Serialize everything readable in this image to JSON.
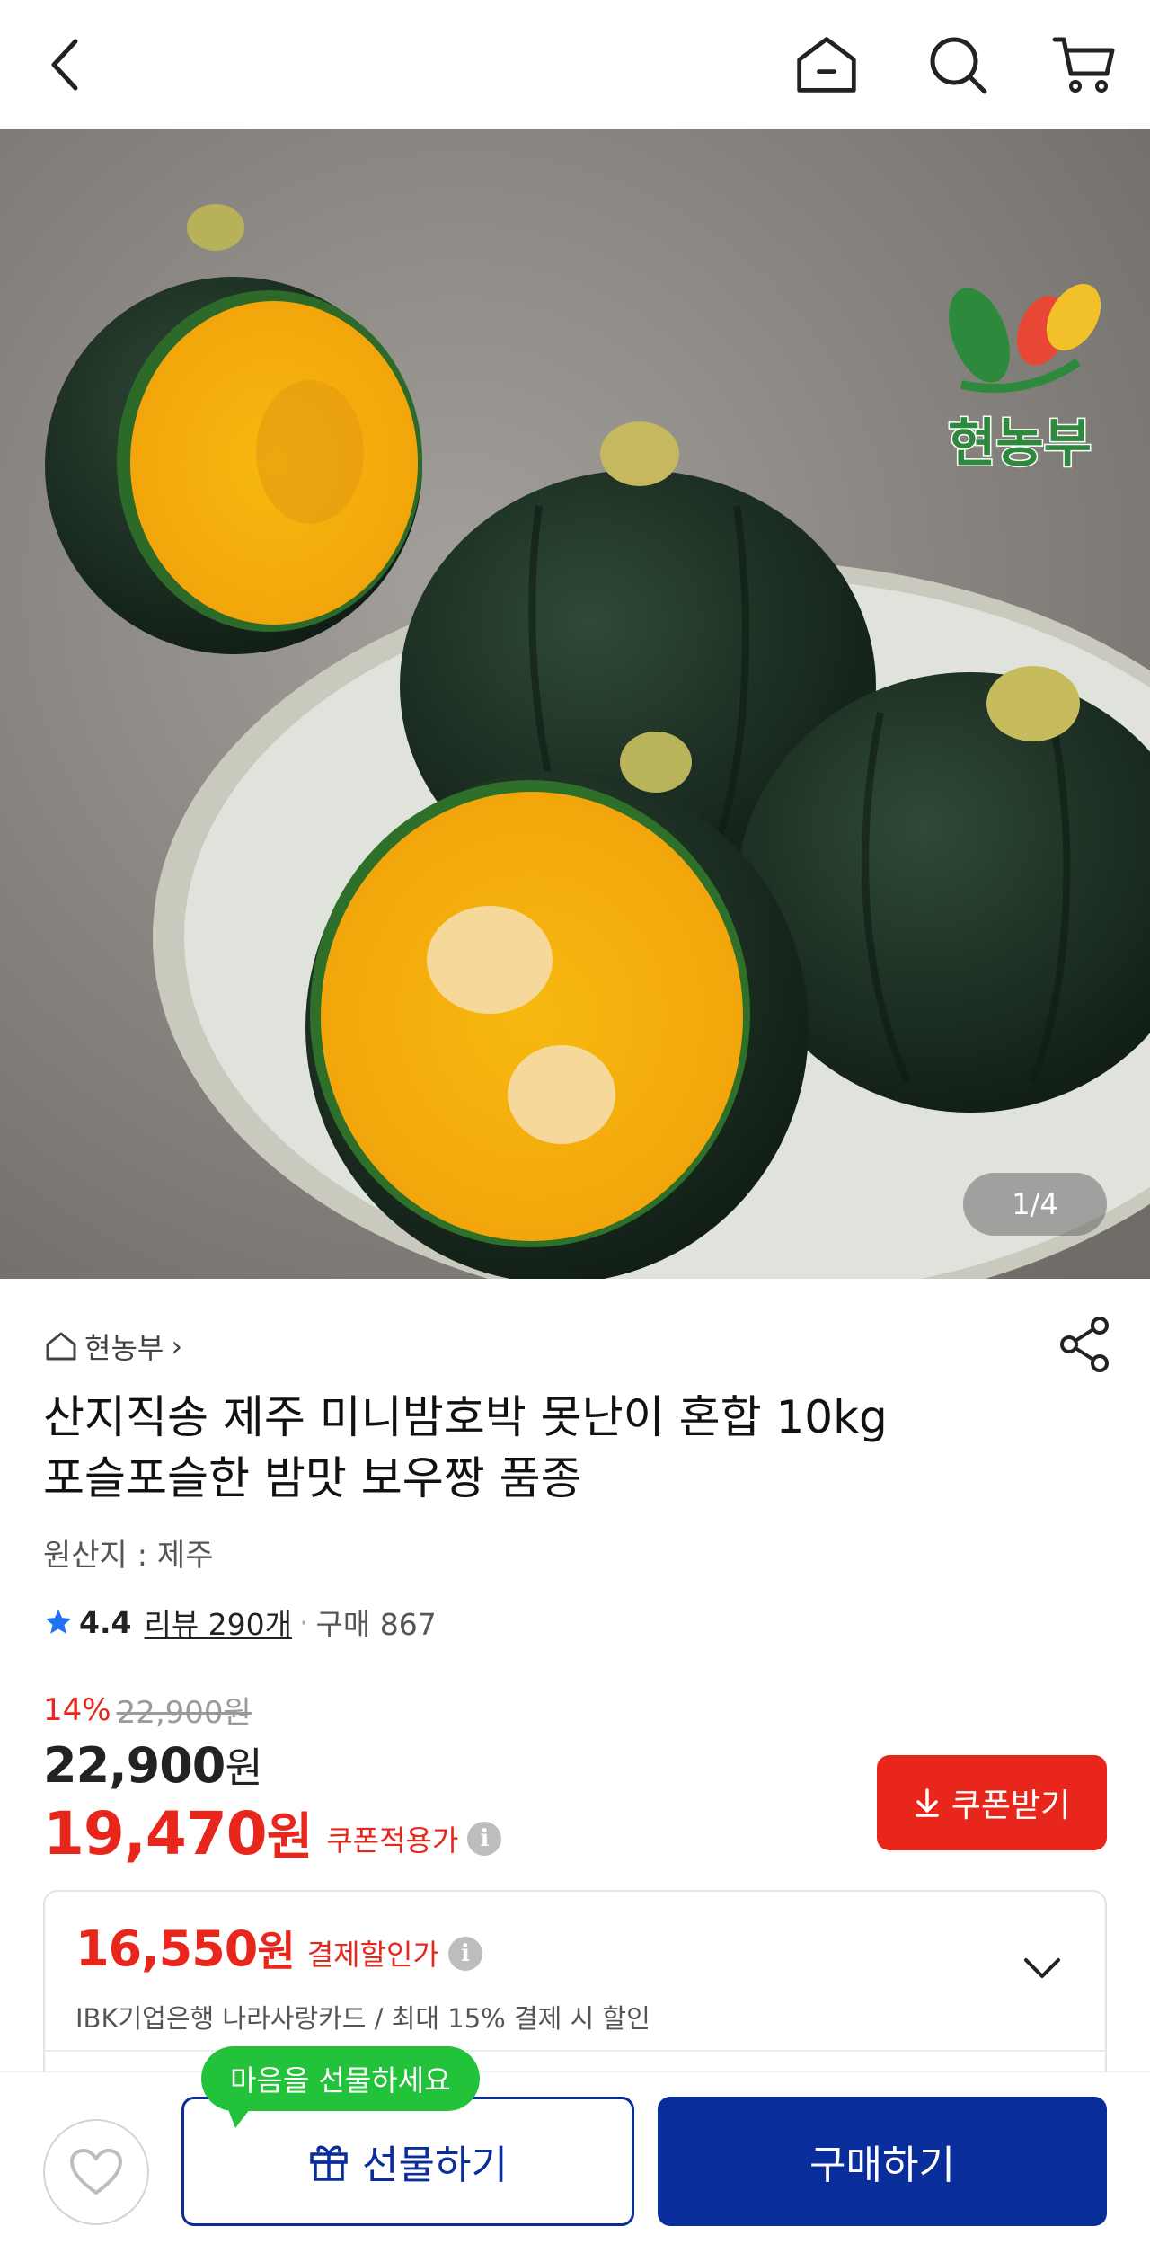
{
  "topbar": {
    "back_icon": "chevron-left-icon",
    "home_icon": "home-icon",
    "search_icon": "search-icon",
    "cart_icon": "cart-icon"
  },
  "gallery": {
    "counter": "1/4",
    "watermark_brand": "현농부"
  },
  "store": {
    "name": "현농부",
    "arrow": "›"
  },
  "product": {
    "title_line1": "산지직송 제주 미니밤호박 못난이 혼합 10kg",
    "title_line2": "포슬포슬한 밤맛 보우짱 품종",
    "origin": "원산지 : 제주",
    "rating": "4.4",
    "reviews": "리뷰 290개",
    "separator": "·",
    "purchases": "구매 867"
  },
  "price": {
    "discount_rate": "14%",
    "original_price": "22,900원",
    "price_number": "22,900",
    "price_unit": "원",
    "coupon_price_number": "19,470",
    "coupon_price_unit": "원",
    "coupon_label": "쿠폰적용가",
    "info_glyph": "i",
    "coupon_button": "쿠폰받기"
  },
  "payment_discount": {
    "amount_number": "16,550",
    "amount_unit": "원",
    "label": "결제할인가",
    "description": "IBK기업은행 나라사랑카드 / 최대 15% 결제 시 할인"
  },
  "bottom": {
    "gift_bubble": "마음을 선물하세요",
    "gift_button": "선물하기",
    "buy_button": "구매하기"
  },
  "colors": {
    "accent_red": "#e8261c",
    "brand_blue": "#0a2d9c",
    "bubble_green": "#22c23a",
    "star_blue": "#1f73f1"
  }
}
